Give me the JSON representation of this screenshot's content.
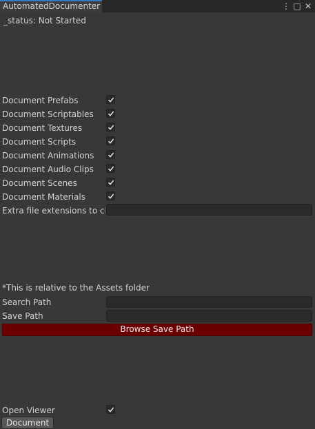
{
  "window": {
    "tab_title": "AutomatedDocumenter",
    "menu_glyph": "⋮",
    "maximize_glyph": "□",
    "close_glyph": "✕"
  },
  "status": {
    "text": "_status: Not Started"
  },
  "toggles": [
    {
      "label": "Document Prefabs",
      "checked": true
    },
    {
      "label": "Document Scriptables",
      "checked": true
    },
    {
      "label": "Document Textures",
      "checked": true
    },
    {
      "label": "Document Scripts",
      "checked": true
    },
    {
      "label": "Document Animations",
      "checked": true
    },
    {
      "label": "Document Audio Clips",
      "checked": true
    },
    {
      "label": "Document Scenes",
      "checked": true
    },
    {
      "label": "Document Materials",
      "checked": true
    }
  ],
  "extra_extensions": {
    "label": "Extra file extensions to che",
    "value": ""
  },
  "note": "*This is relative to the Assets folder",
  "search_path": {
    "label": "Search Path",
    "value": ""
  },
  "save_path": {
    "label": "Save Path",
    "value": ""
  },
  "browse_button": {
    "label": "Browse Save Path",
    "color": "#6a0000"
  },
  "open_viewer": {
    "label": "Open Viewer",
    "checked": true
  },
  "document_button": {
    "label": "Document"
  }
}
